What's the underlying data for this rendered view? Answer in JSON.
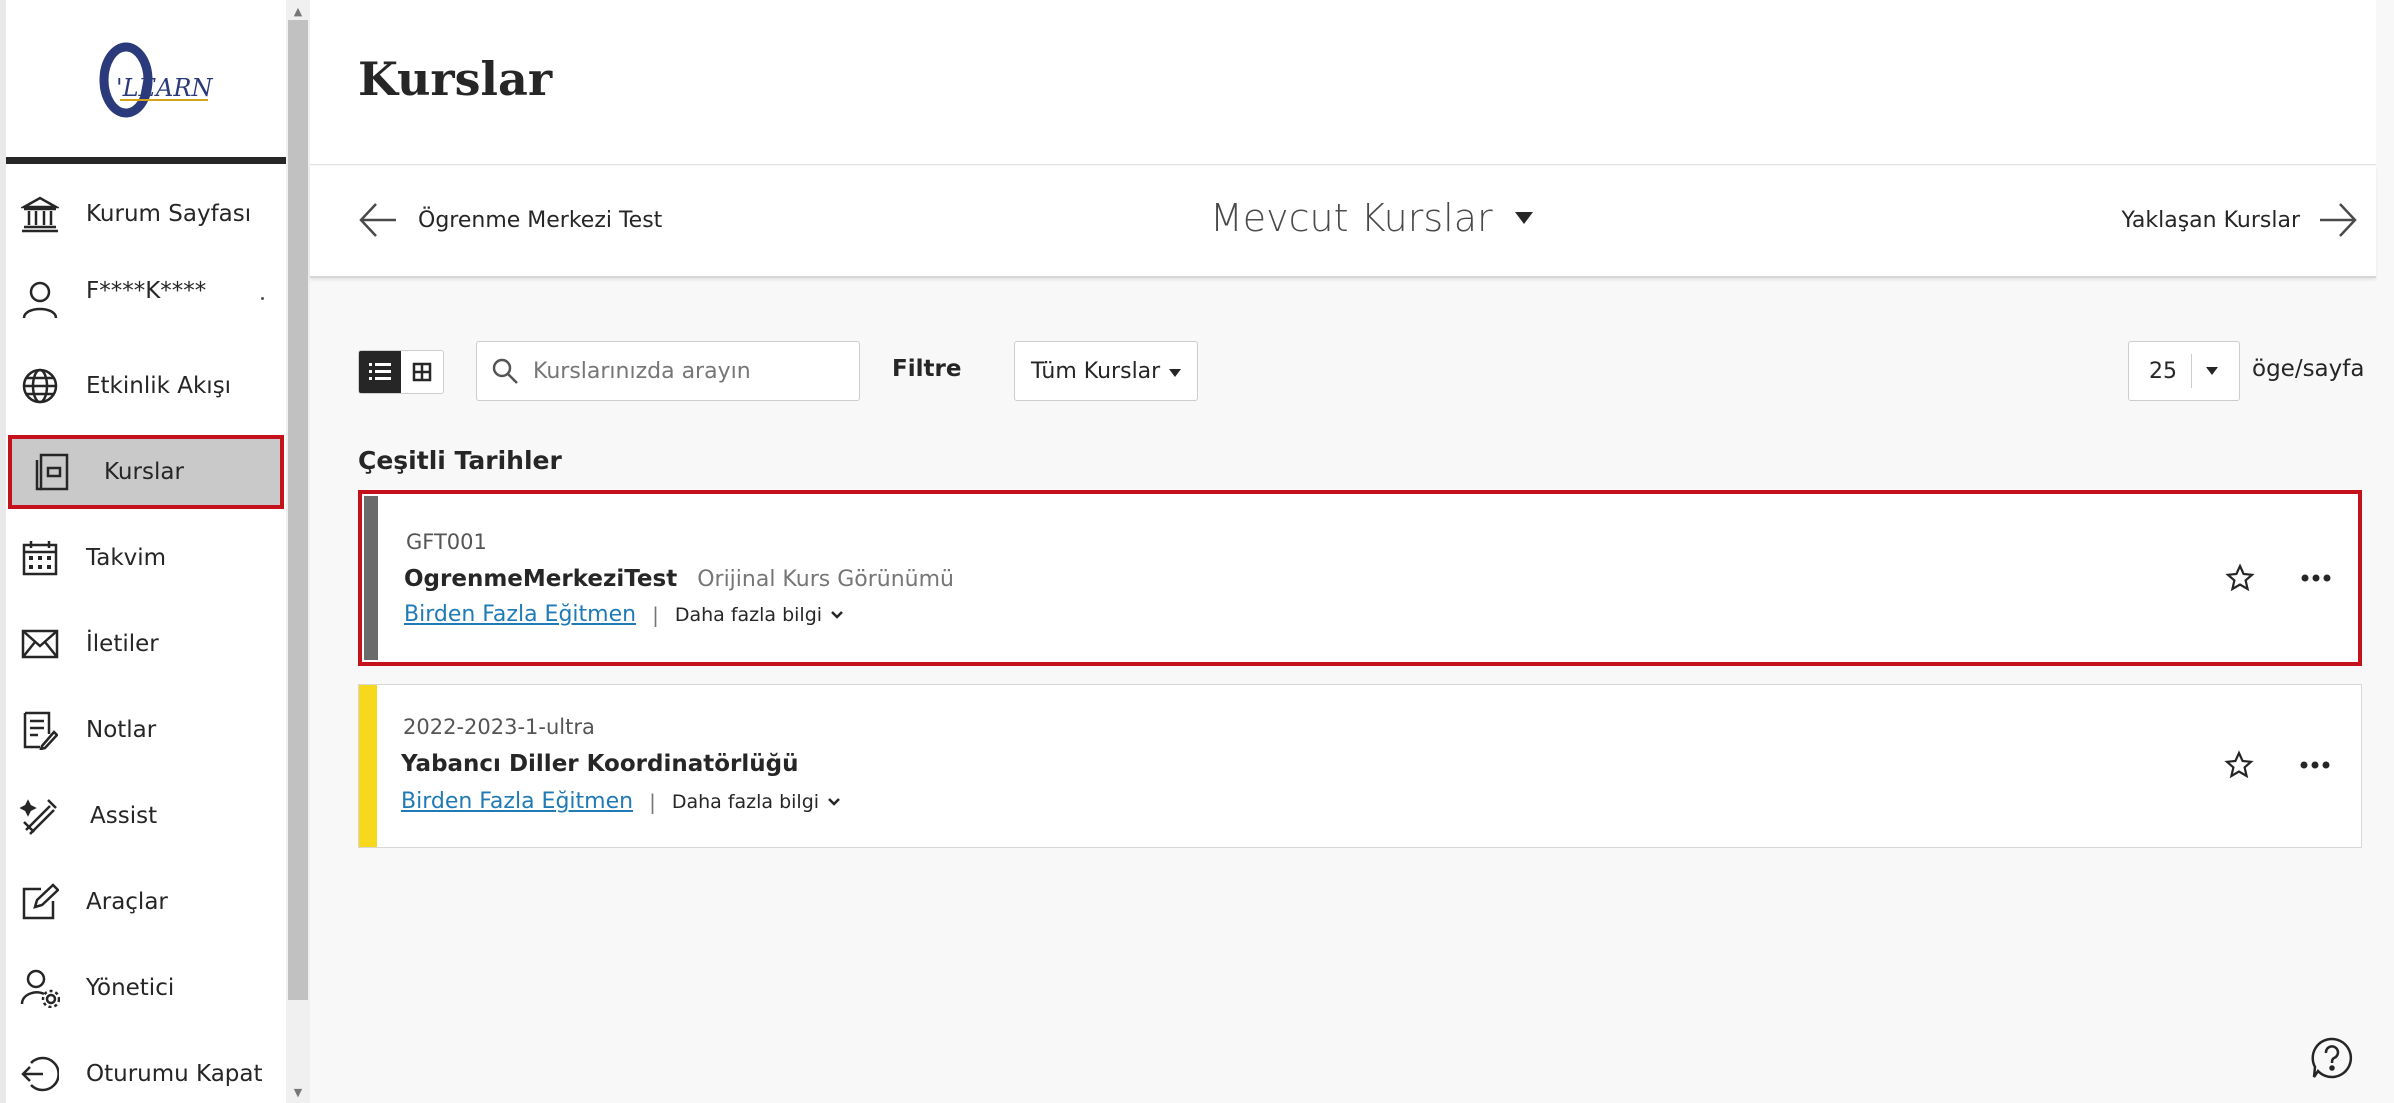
{
  "sidebar": {
    "logo_text": "O'LEARN",
    "items": [
      {
        "label": "Kurum Sayfası",
        "icon": "institution-icon"
      },
      {
        "label": "F****K****",
        "icon": "user-icon"
      },
      {
        "label": "Etkinlik Akışı",
        "icon": "globe-icon"
      },
      {
        "label": "Kurslar",
        "icon": "courses-icon",
        "active": true
      },
      {
        "label": "Takvim",
        "icon": "calendar-icon"
      },
      {
        "label": "İletiler",
        "icon": "envelope-icon"
      },
      {
        "label": "Notlar",
        "icon": "grades-icon"
      },
      {
        "label": "Assist",
        "icon": "assist-icon"
      },
      {
        "label": "Araçlar",
        "icon": "tools-icon"
      },
      {
        "label": "Yönetici",
        "icon": "admin-icon"
      },
      {
        "label": "Oturumu Kapat",
        "icon": "sign-out-icon"
      }
    ]
  },
  "header": {
    "title": "Kurslar"
  },
  "term_nav": {
    "previous": "Ögrenme Merkezi Test",
    "current": "Mevcut Kurslar",
    "next": "Yaklaşan Kurslar"
  },
  "toolbar": {
    "search_placeholder": "Kurslarınızda arayın",
    "filter_label": "Filtre",
    "filter_value": "Tüm Kurslar",
    "per_page_value": "25",
    "per_page_label": "öge/sayfa"
  },
  "section": {
    "heading": "Çeşitli Tarihler"
  },
  "courses": [
    {
      "id": "GFT001",
      "name": "OgrenmeMerkeziTest",
      "view": "Orijinal Kurs Görünümü",
      "instructor": "Birden Fazla Eğitmen",
      "more_info": "Daha fazla bilgi",
      "stripe_color": "#6b6b6b"
    },
    {
      "id": "2022-2023-1-ultra",
      "name": "Yabancı Diller Koordinatörlüğü",
      "view": "",
      "instructor": "Birden Fazla Eğitmen",
      "more_info": "Daha fazla bilgi",
      "stripe_color": "#f8d81c"
    }
  ],
  "colors": {
    "highlight_border": "#c4111c",
    "link": "#1f7ab6",
    "active_nav_bg": "#c9c9c9"
  }
}
